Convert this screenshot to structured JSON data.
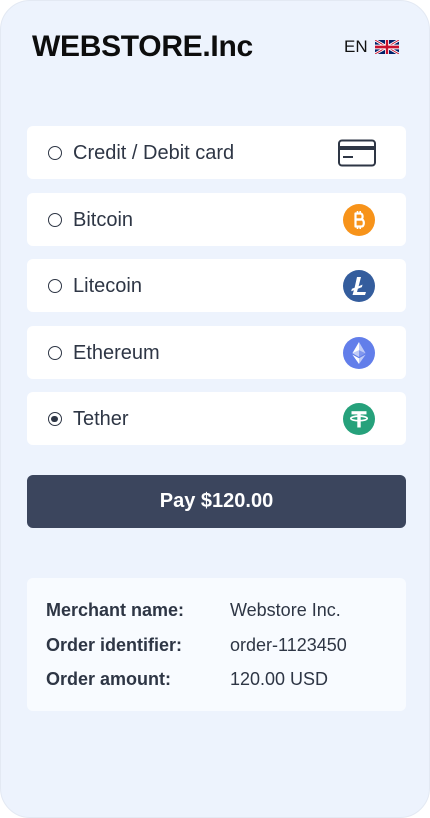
{
  "brand": {
    "name": "WEBSTORE.Inc"
  },
  "language": {
    "code": "EN",
    "flag_icon": "uk-flag-icon"
  },
  "methods": [
    {
      "label": "Credit / Debit card",
      "icon": "credit-card-icon",
      "selected": false
    },
    {
      "label": "Bitcoin",
      "icon": "bitcoin-icon",
      "color": "#f7931a",
      "selected": false
    },
    {
      "label": "Litecoin",
      "icon": "litecoin-icon",
      "color": "#345d9d",
      "selected": false
    },
    {
      "label": "Ethereum",
      "icon": "ethereum-icon",
      "color": "#627eea",
      "selected": false
    },
    {
      "label": "Tether",
      "icon": "tether-icon",
      "color": "#26a17b",
      "selected": true
    }
  ],
  "pay_button": {
    "label": "Pay $120.00"
  },
  "order_info": {
    "merchant_label": "Merchant name:",
    "merchant_value": "Webstore Inc.",
    "order_id_label": "Order identifier:",
    "order_id_value": "order-1123450",
    "amount_label": "Order amount:",
    "amount_value": "120.00 USD"
  },
  "colors": {
    "background": "#edf3fd",
    "card": "#ffffff",
    "text": "#2e3645",
    "button": "#3b455d"
  }
}
